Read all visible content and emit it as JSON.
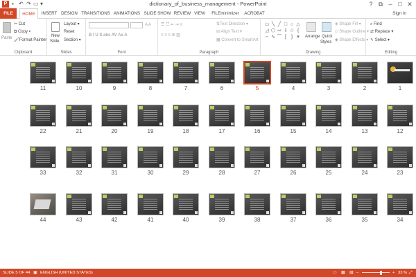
{
  "window": {
    "title": "dictionary_of_business_management - PowerPoint",
    "app_icon": "P",
    "controls": [
      "?",
      "⧉",
      "–",
      "□",
      "✕"
    ]
  },
  "tabs": [
    {
      "label": "FILE"
    },
    {
      "label": "HOME"
    },
    {
      "label": "INSERT"
    },
    {
      "label": "DESIGN"
    },
    {
      "label": "TRANSITIONS"
    },
    {
      "label": "ANIMATIONS"
    },
    {
      "label": "SLIDE SHOW"
    },
    {
      "label": "REVIEW"
    },
    {
      "label": "VIEW"
    },
    {
      "label": "FILEminimizer"
    },
    {
      "label": "ACROBAT"
    }
  ],
  "signin": "Sign in",
  "ribbon": {
    "clipboard": {
      "paste": "Paste",
      "cut": "Cut",
      "copy": "Copy",
      "format_painter": "Format Painter",
      "label": "Clipboard"
    },
    "slides": {
      "new_slide": "New",
      "new_slide2": "Slide",
      "layout": "Layout",
      "reset": "Reset",
      "section": "Section",
      "label": "Slides"
    },
    "font": {
      "label": "Font"
    },
    "paragraph": {
      "text_direction": "Text Direction",
      "align_text": "Align Text",
      "convert": "Convert to SmartArt",
      "label": "Paragraph"
    },
    "drawing": {
      "arrange": "Arrange",
      "quick_styles": "Quick",
      "quick_styles2": "Styles",
      "shape_fill": "Shape Fill",
      "shape_outline": "Shape Outline",
      "shape_effects": "Shape Effects",
      "label": "Drawing"
    },
    "editing": {
      "find": "Find",
      "replace": "Replace",
      "select": "Select",
      "label": "Editing"
    }
  },
  "slides": {
    "row1": [
      "11",
      "10",
      "9",
      "8",
      "7",
      "6",
      "5",
      "4",
      "3",
      "2",
      "1"
    ],
    "row2": [
      "22",
      "21",
      "20",
      "19",
      "18",
      "17",
      "16",
      "15",
      "14",
      "13",
      "12"
    ],
    "row3": [
      "33",
      "32",
      "31",
      "30",
      "29",
      "28",
      "27",
      "26",
      "25",
      "24",
      "23"
    ],
    "row4": [
      "44",
      "43",
      "42",
      "41",
      "40",
      "39",
      "38",
      "37",
      "36",
      "35",
      "34"
    ],
    "selected": "5"
  },
  "status": {
    "slide": "SLIDE 5 OF 44",
    "language": "ENGLISH (UNITED STATES)",
    "zoom": "33 %"
  },
  "colors": {
    "accent": "#d24726"
  }
}
